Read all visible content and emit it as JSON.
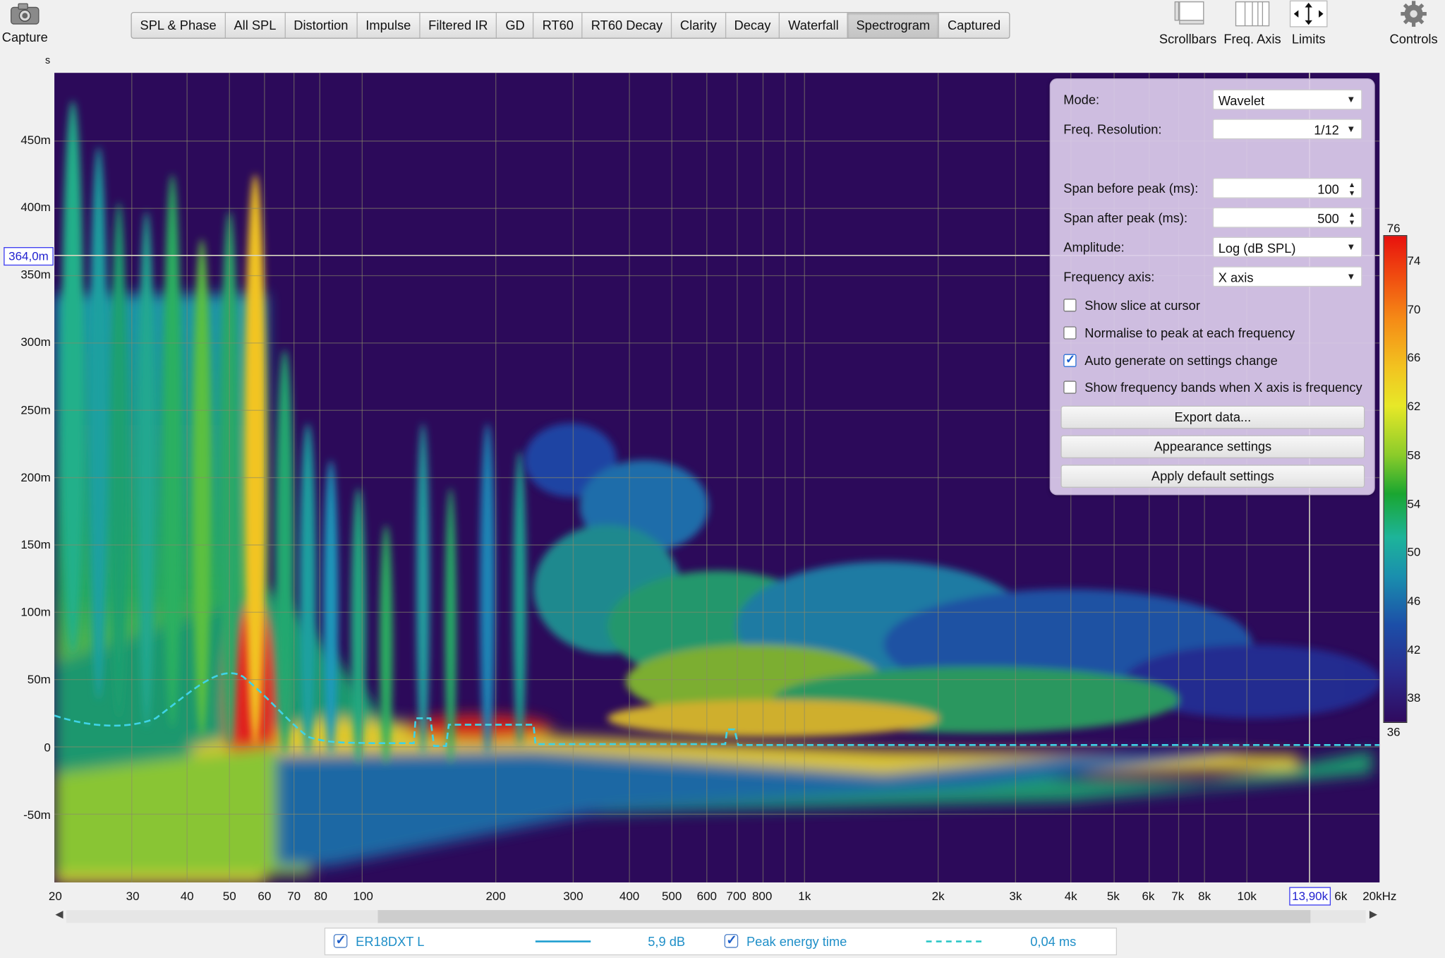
{
  "toolbar": {
    "capture_label": "Capture",
    "scrollbars_label": "Scrollbars",
    "freq_axis_label": "Freq. Axis",
    "limits_label": "Limits",
    "controls_label": "Controls"
  },
  "tabs": [
    {
      "label": "SPL & Phase"
    },
    {
      "label": "All SPL"
    },
    {
      "label": "Distortion"
    },
    {
      "label": "Impulse"
    },
    {
      "label": "Filtered IR"
    },
    {
      "label": "GD"
    },
    {
      "label": "RT60"
    },
    {
      "label": "RT60 Decay"
    },
    {
      "label": "Clarity"
    },
    {
      "label": "Decay"
    },
    {
      "label": "Waterfall"
    },
    {
      "label": "Spectrogram",
      "active": true
    },
    {
      "label": "Captured"
    }
  ],
  "plot": {
    "y_unit": "s",
    "y_ticks": [
      "450m",
      "400m",
      "350m",
      "300m",
      "250m",
      "200m",
      "150m",
      "100m",
      "50m",
      "0",
      "-50m"
    ],
    "x_ticks": [
      "20",
      "30",
      "40",
      "50",
      "60",
      "70",
      "80",
      "100",
      "200",
      "300",
      "400",
      "500",
      "600",
      "700",
      "800",
      "1k",
      "2k",
      "3k",
      "4k",
      "5k",
      "6k",
      "7k",
      "8k",
      "10k",
      "6k",
      "20kHz"
    ],
    "cursor_y": "364,0m",
    "cursor_x": "13,90k"
  },
  "panel": {
    "mode_label": "Mode:",
    "mode_value": "Wavelet",
    "freq_res_label": "Freq. Resolution:",
    "freq_res_value": "1/12",
    "span_before_label": "Span before peak (ms):",
    "span_before_value": "100",
    "span_after_label": "Span after peak (ms):",
    "span_after_value": "500",
    "amplitude_label": "Amplitude:",
    "amplitude_value": "Log (dB SPL)",
    "freq_axis_label": "Frequency axis:",
    "freq_axis_value": "X axis",
    "show_slice_label": "Show slice at cursor",
    "show_slice_checked": false,
    "normalise_label": "Normalise to peak at each frequency",
    "normalise_checked": false,
    "auto_generate_label": "Auto generate on settings change",
    "auto_generate_checked": true,
    "show_bands_label": "Show frequency bands when X axis is frequency",
    "show_bands_checked": false,
    "export_label": "Export data...",
    "appearance_label": "Appearance settings",
    "apply_default_label": "Apply default settings"
  },
  "colorbar": {
    "max": "76",
    "min": "36",
    "ticks": [
      "74",
      "70",
      "66",
      "62",
      "58",
      "54",
      "50",
      "46",
      "42",
      "38"
    ]
  },
  "legend": {
    "item1_name": "ER18DXT L",
    "item1_value": "5,9 dB",
    "item2_name": "Peak energy time",
    "item2_value": "0,04 ms"
  }
}
